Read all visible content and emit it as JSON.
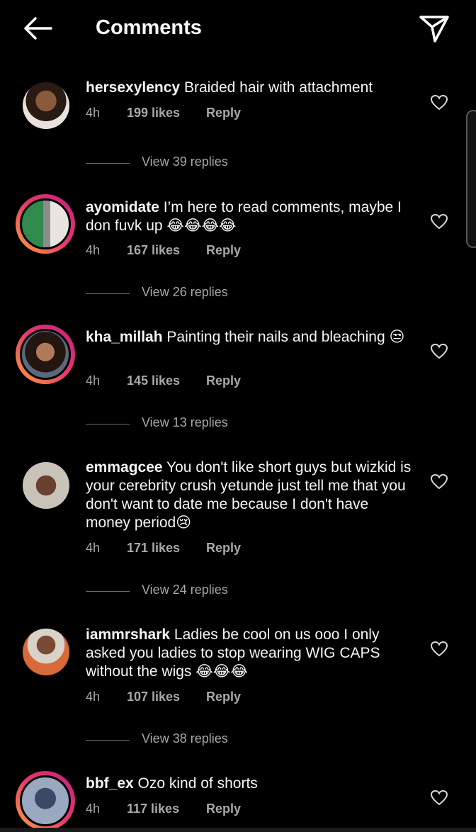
{
  "header": {
    "title": "Comments",
    "back_icon": "back-arrow-icon",
    "send_icon": "direct-send-icon"
  },
  "comments": [
    {
      "username": "hersexylency",
      "text": "Braided hair with attachment",
      "time": "4h",
      "likes": "199 likes",
      "reply": "Reply",
      "view_replies": "View 39 replies"
    },
    {
      "username": "ayomidate",
      "text": "I’m here to read comments, maybe I don fuvk up 😂😂😂😂",
      "time": "4h",
      "likes": "167 likes",
      "reply": "Reply",
      "view_replies": "View 26 replies"
    },
    {
      "username": "kha_millah",
      "text": "Painting their nails and bleaching 😒",
      "time": "4h",
      "likes": "145 likes",
      "reply": "Reply",
      "view_replies": "View 13 replies"
    },
    {
      "username": "emmagcee",
      "text": "You don't like short guys but wizkid is your cerebrity crush yetunde just tell me that you don't want to date me because I don't have money period😢",
      "time": "4h",
      "likes": "171 likes",
      "reply": "Reply",
      "view_replies": "View 24 replies"
    },
    {
      "username": "iammrshark",
      "text": "Ladies be cool on us ooo I only asked you ladies to stop wearing WIG CAPS without the wigs 😂😂😂",
      "time": "4h",
      "likes": "107 likes",
      "reply": "Reply",
      "view_replies": "View 38 replies"
    },
    {
      "username": "bbf_ex",
      "text": "Ozo kind of shorts",
      "time": "4h",
      "likes": "117 likes",
      "reply": "Reply"
    }
  ]
}
